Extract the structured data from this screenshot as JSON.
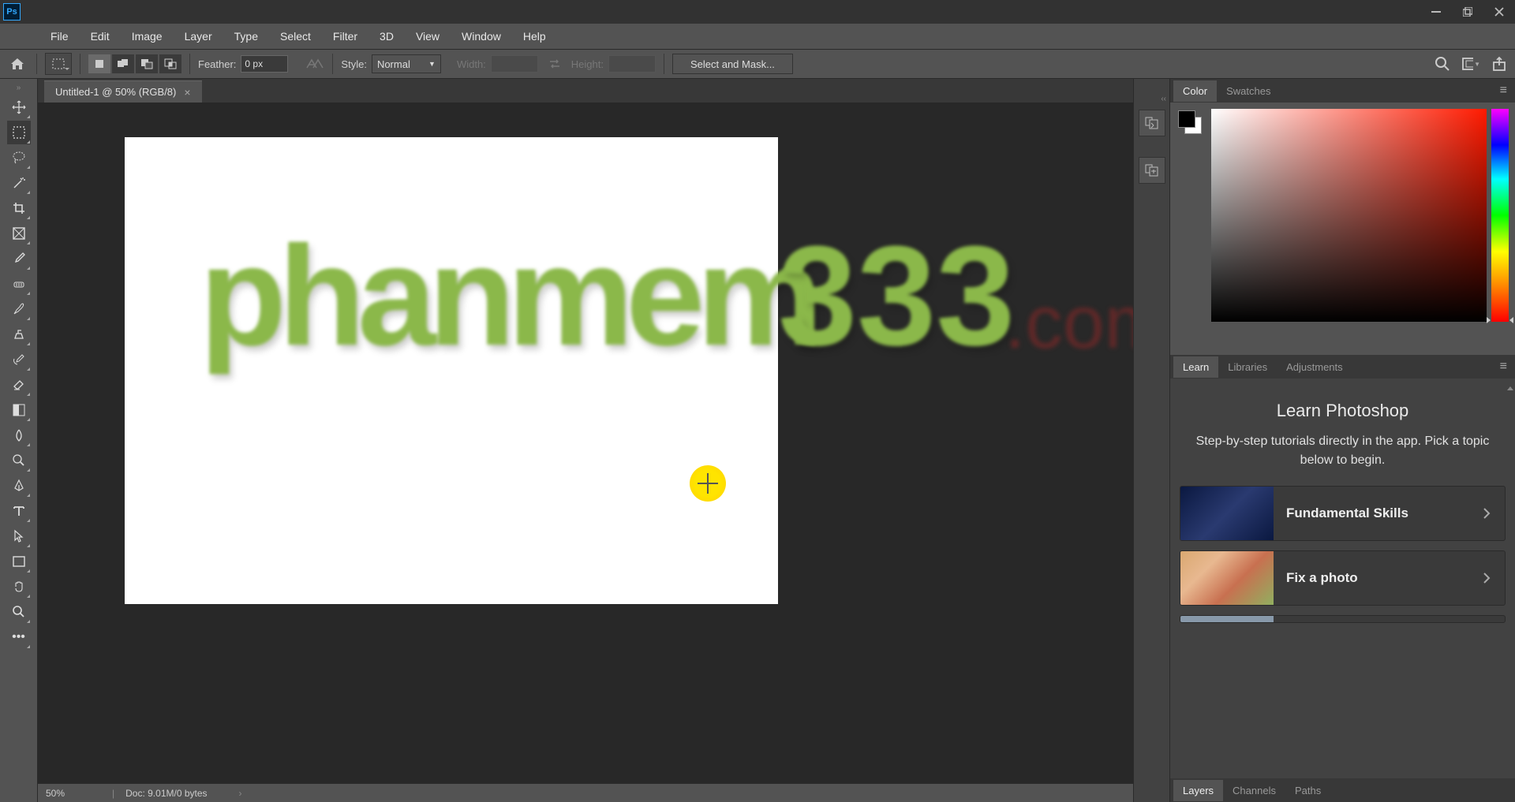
{
  "menubar": [
    "File",
    "Edit",
    "Image",
    "Layer",
    "Type",
    "Select",
    "Filter",
    "3D",
    "View",
    "Window",
    "Help"
  ],
  "options": {
    "feather_label": "Feather:",
    "feather_value": "0 px",
    "style_label": "Style:",
    "style_value": "Normal",
    "width_label": "Width:",
    "height_label": "Height:",
    "mask_btn": "Select and Mask..."
  },
  "doc": {
    "tab_title": "Untitled-1 @ 50% (RGB/8)",
    "zoom": "50%",
    "docinfo": "Doc: 9.01M/0 bytes"
  },
  "watermark": {
    "green": "phanmem",
    "num": "333",
    "com": ".com"
  },
  "panels": {
    "color_tabs": [
      "Color",
      "Swatches"
    ],
    "learn_tabs": [
      "Learn",
      "Libraries",
      "Adjustments"
    ],
    "learn_title": "Learn Photoshop",
    "learn_desc": "Step-by-step tutorials directly in the app. Pick a topic below to begin.",
    "tut1": "Fundamental Skills",
    "tut2": "Fix a photo",
    "layers_tabs": [
      "Layers",
      "Channels",
      "Paths"
    ]
  }
}
